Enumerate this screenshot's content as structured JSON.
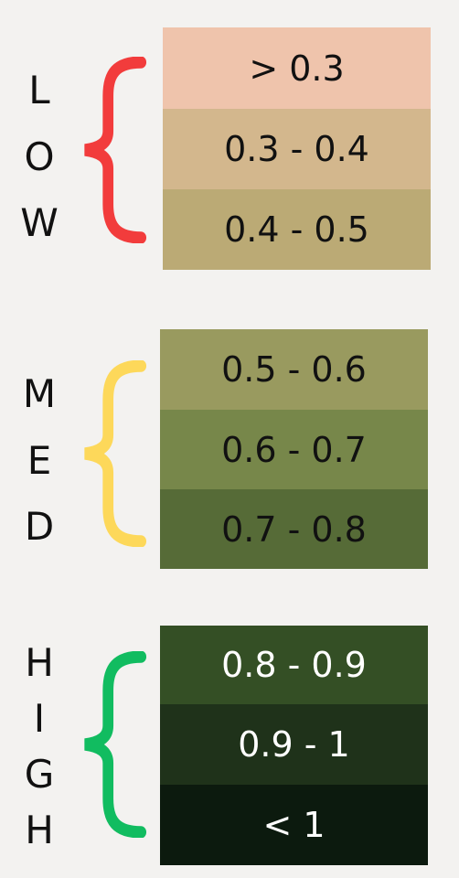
{
  "groups": [
    {
      "letters": [
        "L",
        "O",
        "W"
      ],
      "brace_color": "#f23c3c",
      "rows": [
        {
          "label": "> 0.3",
          "bg": "#efc4ac",
          "fg": "#111111"
        },
        {
          "label": "0.3 - 0.4",
          "bg": "#d3b78d",
          "fg": "#111111"
        },
        {
          "label": "0.4 - 0.5",
          "bg": "#bbaa75",
          "fg": "#111111"
        }
      ]
    },
    {
      "letters": [
        "M",
        "E",
        "D"
      ],
      "brace_color": "#fdd85a",
      "rows": [
        {
          "label": "0.5 - 0.6",
          "bg": "#999a5f",
          "fg": "#111111"
        },
        {
          "label": "0.6 - 0.7",
          "bg": "#77874a",
          "fg": "#111111"
        },
        {
          "label": "0.7 - 0.8",
          "bg": "#566b37",
          "fg": "#111111"
        }
      ]
    },
    {
      "letters": [
        "H",
        "I",
        "G",
        "H"
      ],
      "brace_color": "#11bc60",
      "rows": [
        {
          "label": "0.8 - 0.9",
          "bg": "#344f25",
          "fg": "#ffffff"
        },
        {
          "label": "0.9 - 1",
          "bg": "#1f321a",
          "fg": "#ffffff"
        },
        {
          "label": "< 1",
          "bg": "#0c1a0e",
          "fg": "#ffffff"
        }
      ]
    }
  ]
}
